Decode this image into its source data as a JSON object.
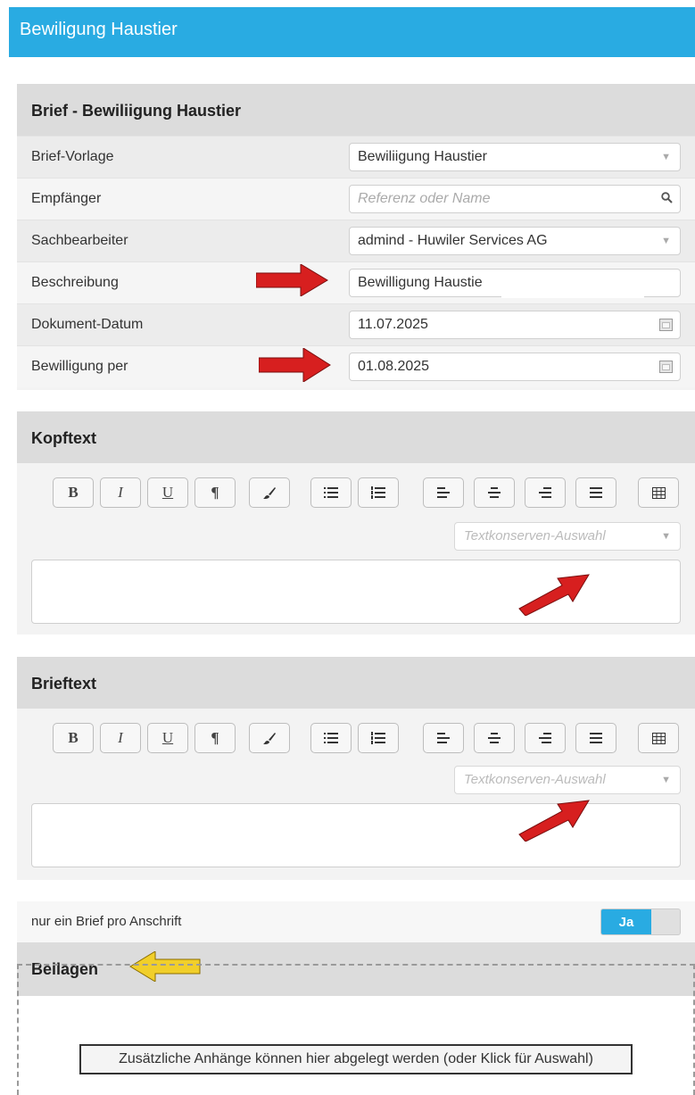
{
  "window": {
    "title": "Bewiligung Haustier"
  },
  "brief": {
    "title": "Brief - Bewiliigung Haustier",
    "rows": [
      {
        "label": "Brief-Vorlage",
        "value": "Bewiliigung Haustier",
        "placeholder": ""
      },
      {
        "label": "Empfänger",
        "value": "",
        "placeholder": "Referenz oder Name"
      },
      {
        "label": "Sachbearbeiter",
        "value": "admind - Huwiler Services AG",
        "placeholder": ""
      },
      {
        "label": "Beschreibung",
        "value": "Bewilligung Haustie",
        "placeholder": ""
      },
      {
        "label": "Dokument-Datum",
        "value": "11.07.2025",
        "placeholder": ""
      },
      {
        "label": "Bewilligung per",
        "value": "01.08.2025",
        "placeholder": ""
      }
    ]
  },
  "kopftext": {
    "title": "Kopftext",
    "textkonserven_placeholder": "Textkonserven-Auswahl"
  },
  "brieftext": {
    "title": "Brieftext",
    "textkonserven_placeholder": "Textkonserven-Auswahl"
  },
  "toolbar": {
    "buttons": [
      {
        "name": "bold-button",
        "glyph": "B"
      },
      {
        "name": "italic-button",
        "glyph": "I"
      },
      {
        "name": "underline-button",
        "glyph": "U"
      },
      {
        "name": "paragraph-button",
        "glyph": "¶"
      },
      {
        "name": "brush-button",
        "glyph": "brush-icon"
      },
      {
        "name": "bullet-list-button",
        "glyph": "bullet-list-icon"
      },
      {
        "name": "numbered-list-button",
        "glyph": "numbered-list-icon"
      },
      {
        "name": "align-left-button",
        "glyph": "align-left-icon"
      },
      {
        "name": "align-center-button",
        "glyph": "align-center-icon"
      },
      {
        "name": "align-right-button",
        "glyph": "align-right-icon"
      },
      {
        "name": "align-justify-button",
        "glyph": "align-justify-icon"
      },
      {
        "name": "table-button",
        "glyph": "table-icon"
      }
    ]
  },
  "option": {
    "label": "nur ein Brief pro Anschrift",
    "toggle_on": "Ja"
  },
  "beilagen": {
    "title": "Beilagen",
    "drop_text": "Zusätzliche Anhänge können hier abgelegt werden (oder Klick für Auswahl)"
  },
  "colors": {
    "accent": "#29abe2",
    "arrow_red": "#d71f1f",
    "arrow_yellow": "#f1cf2a"
  }
}
